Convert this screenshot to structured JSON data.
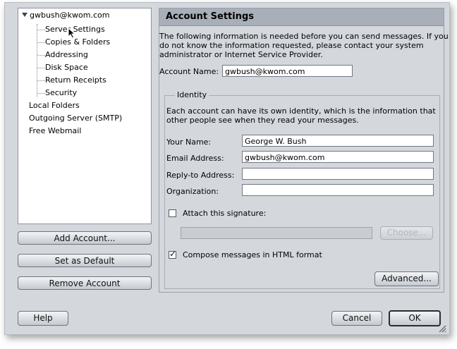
{
  "tree": {
    "account": "gwbush@kwom.com",
    "children": [
      "Server Settings",
      "Copies & Folders",
      "Addressing",
      "Disk Space",
      "Return Receipts",
      "Security"
    ],
    "roots": [
      "Local Folders",
      "Outgoing Server (SMTP)",
      "Free Webmail"
    ]
  },
  "account_buttons": {
    "add": "Add Account...",
    "default": "Set as Default",
    "remove": "Remove Account"
  },
  "panel": {
    "title": "Account Settings",
    "intro": [
      "The following information is needed before you can send messages. If you",
      "do not know the information requested, please contact your system",
      "administrator or Internet Service Provider."
    ],
    "account_name_label": "Account Name:",
    "account_name_value": "gwbush@kwom.com",
    "identity": {
      "legend": "Identity",
      "desc": [
        "Each account can have its own identity, which is the information that",
        "other people see when they read your messages."
      ],
      "your_name_label": "Your Name:",
      "your_name_value": "George W. Bush",
      "email_label": "Email Address:",
      "email_value": "gwbush@kwom.com",
      "reply_to_label": "Reply-to Address:",
      "reply_to_value": "",
      "organization_label": "Organization:",
      "organization_value": "",
      "signature_label": "Attach this signature:",
      "signature_checked": false,
      "signature_path": "",
      "choose_label": "Choose...",
      "html_label": "Compose messages in HTML format",
      "html_checked": true,
      "advanced_label": "Advanced..."
    }
  },
  "footer": {
    "help": "Help",
    "cancel": "Cancel",
    "ok": "OK"
  }
}
